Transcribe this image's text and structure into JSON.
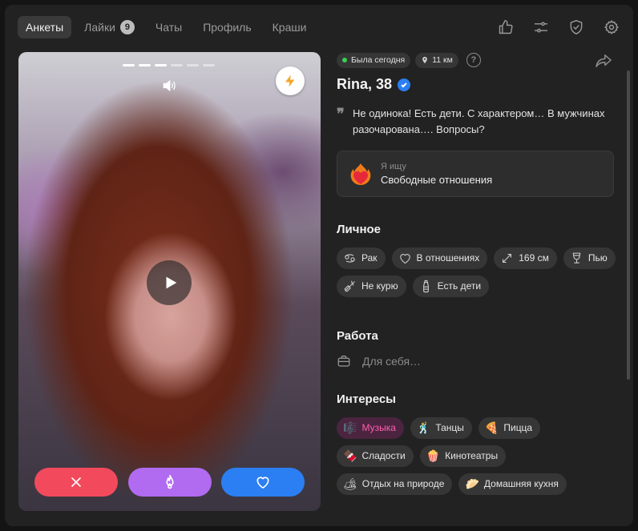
{
  "nav": {
    "tabs": [
      {
        "label": "Анкеты",
        "active": true
      },
      {
        "label": "Лайки",
        "badge": "9"
      },
      {
        "label": "Чаты"
      },
      {
        "label": "Профиль"
      },
      {
        "label": "Краши"
      }
    ],
    "icons": [
      "thumbs-up-icon",
      "sliders-icon",
      "shield-check-icon",
      "gear-icon"
    ]
  },
  "photo": {
    "progress_total": 6,
    "progress_active": 3,
    "icons": [
      "volume-icon",
      "bolt-icon",
      "play-icon"
    ],
    "actions": [
      "close-icon",
      "flame-icon",
      "heart-icon"
    ],
    "colors": {
      "dislike": "#f24a5c",
      "superlike": "#b06bf0",
      "like": "#2b7ff2",
      "bolt": "#f5a623"
    }
  },
  "profile": {
    "status": "Была сегодня",
    "distance": "11 км",
    "help": "?",
    "name": "Rina, 38",
    "bio": "Не одинока! Есть дети. С характером… В мужчинах разочарована…. Вопросы?",
    "quote_mark": "❞",
    "seeking": {
      "label": "Я ищу",
      "value": "Свободные отношения"
    }
  },
  "personal": {
    "title": "Личное",
    "items": [
      {
        "label": "Рак",
        "icon": "cancer-zodiac-icon"
      },
      {
        "label": "В отношениях",
        "icon": "heart-outline-icon"
      },
      {
        "label": "169 см",
        "icon": "height-arrows-icon"
      },
      {
        "label": "Пью",
        "icon": "wine-glass-icon"
      },
      {
        "label": "Не курю",
        "icon": "no-smoking-icon"
      },
      {
        "label": "Есть дети",
        "icon": "baby-bottle-icon"
      }
    ]
  },
  "work": {
    "title": "Работа",
    "value": "Для себя…"
  },
  "interests": {
    "title": "Интересы",
    "items": [
      {
        "label": "Музыка",
        "emoji": "🎼",
        "highlight": true
      },
      {
        "label": "Танцы",
        "emoji": "🕺"
      },
      {
        "label": "Пицца",
        "emoji": "🍕"
      },
      {
        "label": "Сладости",
        "emoji": "🍫"
      },
      {
        "label": "Кинотеатры",
        "emoji": "🍿"
      },
      {
        "label": "Отдых на природе",
        "emoji": "🏕"
      },
      {
        "label": "Домашняя кухня",
        "emoji": "🥟"
      }
    ]
  }
}
